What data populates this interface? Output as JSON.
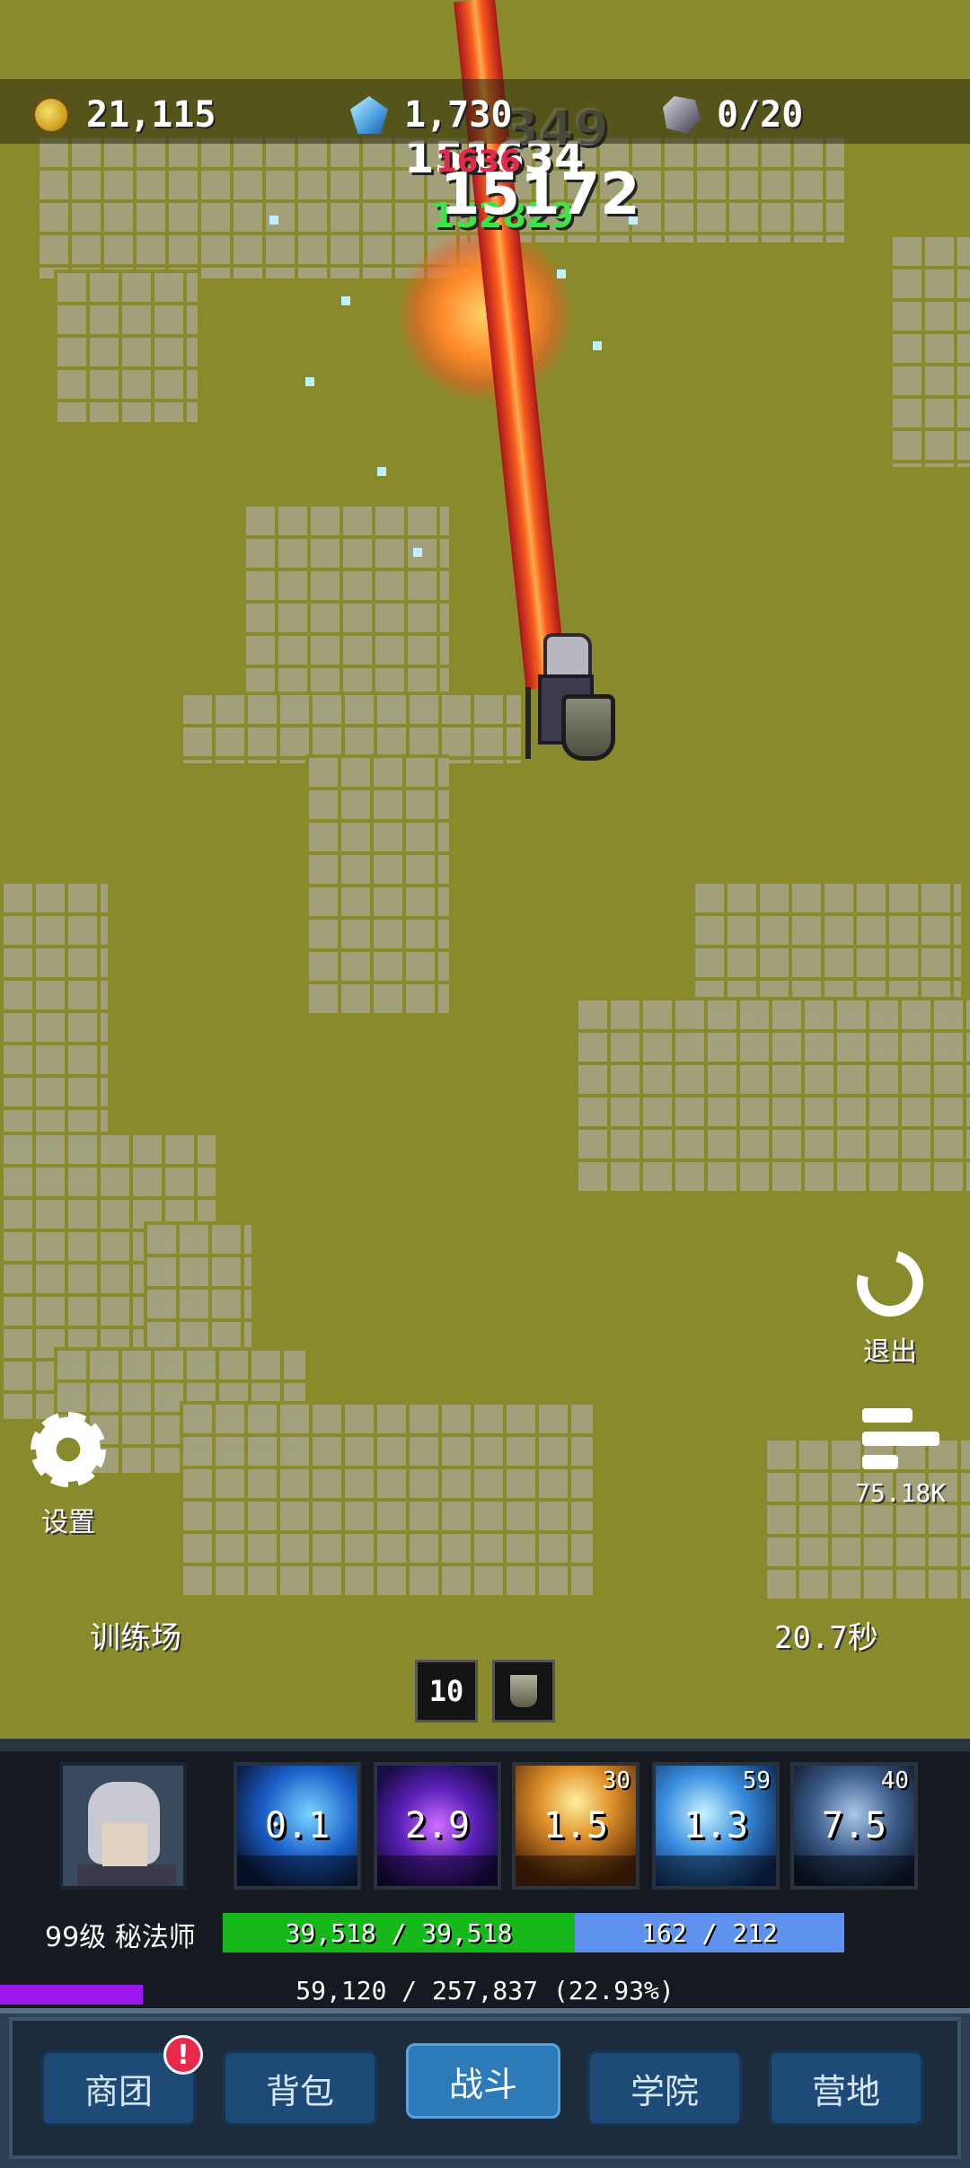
{
  "resources": {
    "gold": {
      "icon": "gold-coin-icon",
      "value": "21,115"
    },
    "gems": {
      "icon": "blue-gem-icon",
      "value": "1,730"
    },
    "stones": {
      "icon": "ore-stone-icon",
      "value": "0/20"
    }
  },
  "damage_numbers": {
    "faded": "349",
    "white_top": "151634",
    "red": "1636",
    "main": "15172",
    "green": "152829"
  },
  "side_buttons": {
    "exit": {
      "icon": "restart-arrow-icon",
      "label": "退出"
    },
    "settings": {
      "icon": "gear-icon",
      "label": "设置"
    },
    "stats": {
      "icon": "damage-stats-icon",
      "label": "75.18K"
    }
  },
  "stage": {
    "name": "训练场",
    "timer": "20.7秒"
  },
  "buffs": [
    {
      "label": "10",
      "icon": "stack-count-icon"
    },
    {
      "label": "",
      "icon": "shield-buff-icon"
    }
  ],
  "hero": {
    "level_class": "99级 秘法师",
    "hp": {
      "text": "39,518 / 39,518",
      "current": 39518,
      "max": 39518
    },
    "mp": {
      "text": "162 / 212",
      "current": 162,
      "max": 212
    },
    "xp": {
      "text": "59,120 / 257,837 (22.93%)",
      "fraction": 0.2293
    }
  },
  "skills": [
    {
      "icon": "ice-blade-skill-icon",
      "cooldown": "0.1",
      "level": ""
    },
    {
      "icon": "arcane-rune-skill-icon",
      "cooldown": "2.9",
      "level": ""
    },
    {
      "icon": "holy-light-skill-icon",
      "cooldown": "1.5",
      "level": "30"
    },
    {
      "icon": "ice-shards-skill-icon",
      "cooldown": "1.3",
      "level": "59"
    },
    {
      "icon": "spirit-twins-skill-icon",
      "cooldown": "7.5",
      "level": "40"
    }
  ],
  "nav": [
    {
      "label": "商团",
      "active": false,
      "alert": "!"
    },
    {
      "label": "背包",
      "active": false
    },
    {
      "label": "战斗",
      "active": true
    },
    {
      "label": "学院",
      "active": false
    },
    {
      "label": "营地",
      "active": false
    }
  ],
  "colors": {
    "hp_bar": "#16b81c",
    "mp_bar": "#5f92ee",
    "xp_bar": "#9a18ee",
    "nav_active": "#2d7ab8",
    "alert": "#e8294b"
  }
}
